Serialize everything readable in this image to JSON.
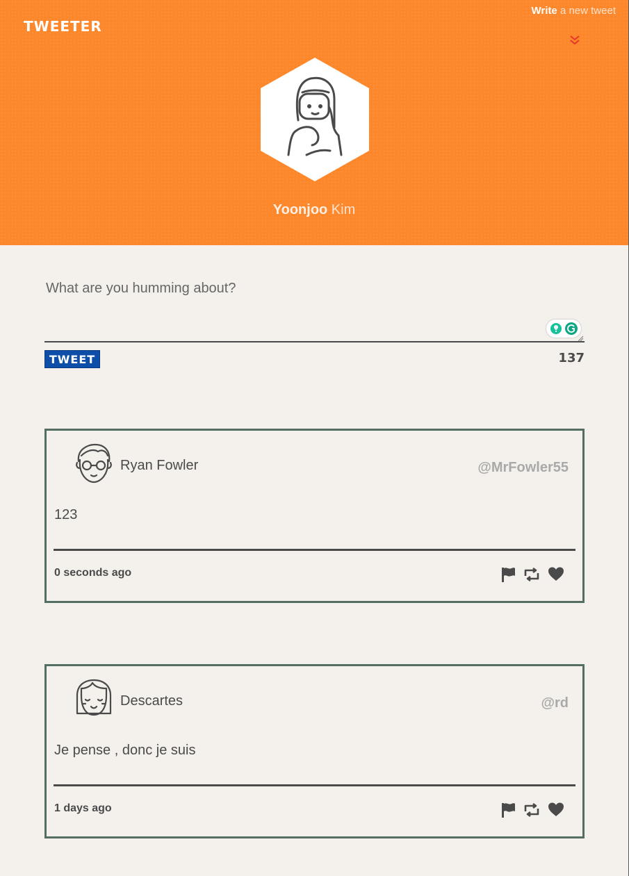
{
  "header": {
    "logo": "TWEETER",
    "write_bold": "Write",
    "write_rest": " a new tweet",
    "user_first": "Yoonjoo",
    "user_last": " Kim"
  },
  "compose": {
    "placeholder": "What are you humming about?",
    "tweet_button": "TWEET",
    "char_count": "137"
  },
  "tweets": [
    {
      "name": "Ryan Fowler",
      "handle": "@MrFowler55",
      "text": "123",
      "time": "0 seconds ago"
    },
    {
      "name": "Descartes",
      "handle": "@rd",
      "text": "Je pense , donc je suis",
      "time": "1 days ago"
    }
  ],
  "icons": {
    "actions": [
      "flag-icon",
      "retweet-icon",
      "heart-icon"
    ]
  },
  "colors": {
    "header_bg": "#fd872b",
    "page_bg": "#f4f1ed",
    "card_border": "#536f63",
    "tweet_button": "#0d4fa8"
  }
}
